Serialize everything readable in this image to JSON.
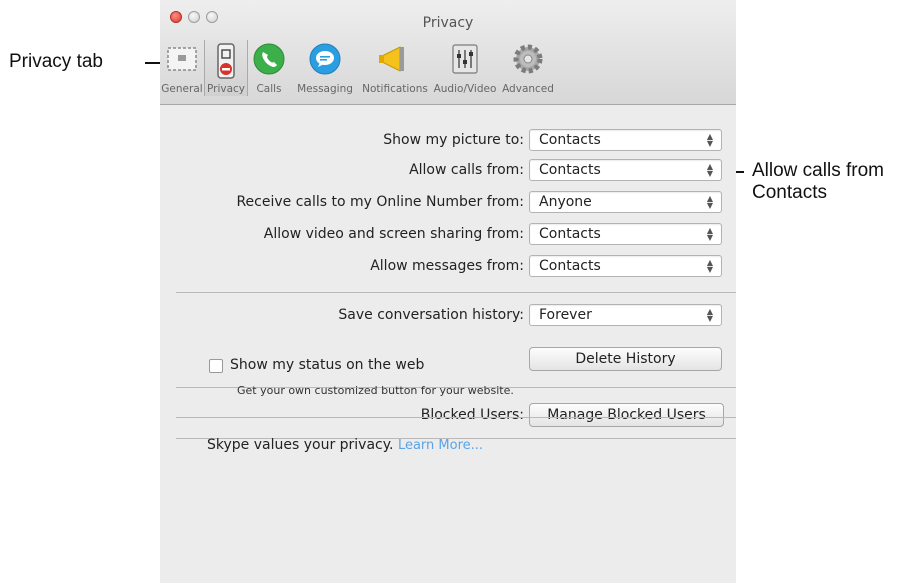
{
  "window": {
    "title": "Privacy",
    "toolbar": [
      {
        "label": "General",
        "icon": "general-icon"
      },
      {
        "label": "Privacy",
        "icon": "privacy-icon"
      },
      {
        "label": "Calls",
        "icon": "calls-icon"
      },
      {
        "label": "Messaging",
        "icon": "messaging-icon"
      },
      {
        "label": "Notifications",
        "icon": "notifications-icon"
      },
      {
        "label": "Audio/Video",
        "icon": "audio-video-icon"
      },
      {
        "label": "Advanced",
        "icon": "advanced-icon"
      }
    ],
    "selected_tab": "Privacy"
  },
  "settings": {
    "show_picture": {
      "label": "Show my picture to:",
      "value": "Contacts"
    },
    "allow_calls": {
      "label": "Allow calls from:",
      "value": "Contacts"
    },
    "online_number": {
      "label": "Receive calls to my Online Number from:",
      "value": "Anyone"
    },
    "video_sharing": {
      "label": "Allow video and screen sharing from:",
      "value": "Contacts"
    },
    "messages": {
      "label": "Allow messages from:",
      "value": "Contacts"
    },
    "history": {
      "label": "Save conversation history:",
      "value": "Forever"
    },
    "delete_history": "Delete History",
    "blocked_label": "Blocked Users:",
    "manage_blocked": "Manage Blocked Users",
    "status_web": {
      "label": "Show my status on the web",
      "sub": "Get your own customized button for your website.",
      "checked": false
    },
    "privacy_note": "Skype values your privacy.",
    "learn_more": "Learn More..."
  },
  "callouts": {
    "privacy_tab": "Privacy tab",
    "allow_calls_line1": "Allow calls from",
    "allow_calls_line2": "Contacts"
  },
  "colors": {
    "close": "#e0443a",
    "calls_green": "#3cae4a",
    "messaging_blue": "#2a9ee0",
    "link": "#5aa4e6"
  }
}
